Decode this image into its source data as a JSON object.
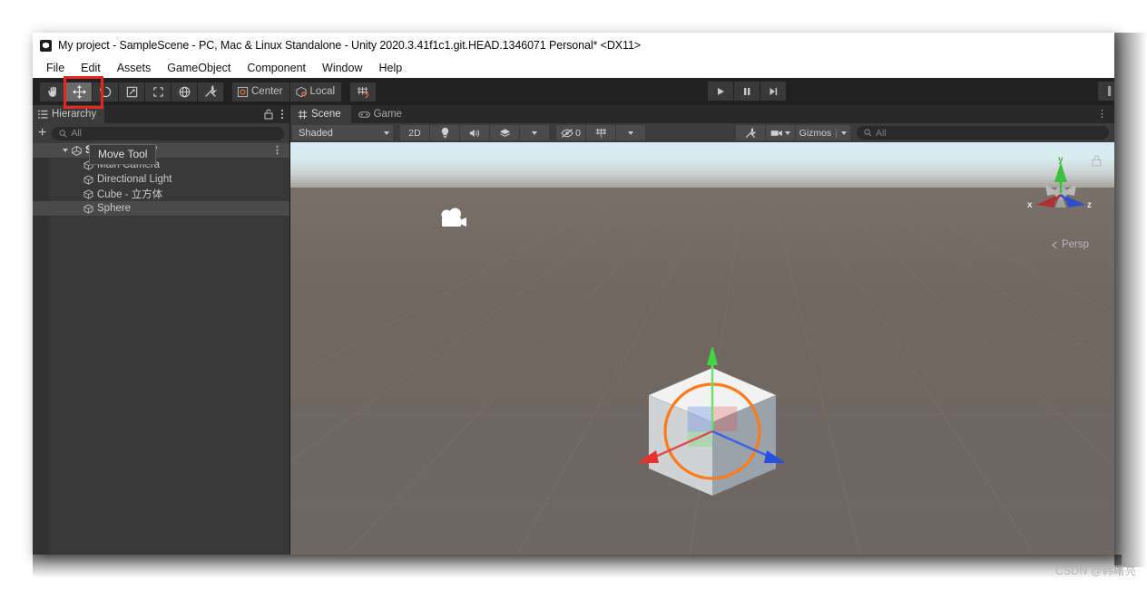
{
  "window": {
    "title": "My project - SampleScene - PC, Mac & Linux Standalone - Unity 2020.3.41f1c1.git.HEAD.1346071 Personal* <DX11>",
    "logo_icon": "unity-logo-icon"
  },
  "menu": {
    "items": [
      {
        "label": "File"
      },
      {
        "label": "Edit"
      },
      {
        "label": "Assets"
      },
      {
        "label": "GameObject"
      },
      {
        "label": "Component"
      },
      {
        "label": "Window"
      },
      {
        "label": "Help"
      }
    ]
  },
  "toolbar": {
    "tools": [
      {
        "name": "hand-tool",
        "icon": "hand-icon",
        "selected": false
      },
      {
        "name": "move-tool",
        "icon": "move-arrows-icon",
        "selected": true
      },
      {
        "name": "rotate-tool",
        "icon": "rotate-icon",
        "selected": false
      },
      {
        "name": "scale-tool",
        "icon": "scale-icon",
        "selected": false
      },
      {
        "name": "rect-tool",
        "icon": "rect-transform-icon",
        "selected": false
      },
      {
        "name": "transform-tool",
        "icon": "transform-globe-icon",
        "selected": false
      },
      {
        "name": "custom-tool",
        "icon": "wrench-screwdriver-icon",
        "selected": false
      }
    ],
    "pivot_label": "Center",
    "pivot_icon": "pivot-center-icon",
    "handle_label": "Local",
    "handle_icon": "handle-local-icon",
    "snap_icon": "grid-snap-icon",
    "play_label": "Play",
    "pause_label": "Pause",
    "step_label": "Step",
    "play_icon": "play-icon",
    "pause_icon": "pause-icon",
    "step_icon": "step-forward-icon"
  },
  "tooltip": {
    "text": "Move Tool"
  },
  "hierarchy": {
    "tab_label": "Hierarchy",
    "tab_icon": "hierarchy-icon",
    "lock_icon": "lock-open-icon",
    "menu_icon": "kebab-menu-icon",
    "add_label": "+",
    "search_placeholder": "All",
    "search_icon": "search-icon",
    "scene_menu_icon": "kebab-menu-icon",
    "root": {
      "label": "SampleScene*",
      "icon": "unity-scene-icon",
      "expanded": true
    },
    "items": [
      {
        "label": "Main Camera",
        "icon": "gameobject-cube-icon",
        "selected": false
      },
      {
        "label": "Directional Light",
        "icon": "gameobject-cube-icon",
        "selected": false
      },
      {
        "label": "Cube - 立方体",
        "icon": "gameobject-cube-icon",
        "selected": false
      },
      {
        "label": "Sphere",
        "icon": "gameobject-cube-icon",
        "selected": true
      }
    ]
  },
  "view_tabs": [
    {
      "label": "Scene",
      "icon": "scene-grid-icon",
      "active": true
    },
    {
      "label": "Game",
      "icon": "gamepad-icon",
      "active": false
    }
  ],
  "scene_toolbar": {
    "draw_mode": "Shaded",
    "draw_mode_caret": "chevron-down-icon",
    "two_d_label": "2D",
    "lighting_icon": "lightbulb-icon",
    "audio_icon": "speaker-icon",
    "effects_icon": "effects-icon",
    "effects_caret": "chevron-down-icon",
    "hidden_icon": "eye-slash-icon",
    "hidden_count": "0",
    "grid_icon": "grid-y-icon",
    "grid_caret": "chevron-down-icon",
    "tools_icon": "wrench-screwdriver-icon",
    "camera_icon": "camera-icon",
    "camera_caret": "chevron-down-icon",
    "gizmos_label": "Gizmos",
    "gizmos_caret": "chevron-down-icon",
    "search_placeholder": "All",
    "search_icon": "search-icon",
    "panel_menu_icon": "kebab-menu-icon"
  },
  "viewport": {
    "persp_label": "Persp",
    "persp_caret_icon": "chevron-left-icon",
    "lock_icon": "lock-closed-icon",
    "camera_gizmo_icon": "scene-camera-icon",
    "axis_gizmo": {
      "x_label": "x",
      "y_label": "y",
      "z_label": "z",
      "x_color": "#b03030",
      "y_color": "#3fbf3f",
      "z_color": "#2f4fc8"
    },
    "selection": {
      "object": "Sphere",
      "outline_color": "#ff7a1a",
      "gizmo": "move-gizmo",
      "axis_x_color": "#e03030",
      "axis_y_color": "#4cd84c",
      "axis_z_color": "#2a5cf0"
    }
  },
  "annotation": {
    "highlight_color": "#e8251f",
    "highlight_target": "move-tool"
  },
  "watermark": {
    "text": "CSDN @韩曙亮"
  }
}
